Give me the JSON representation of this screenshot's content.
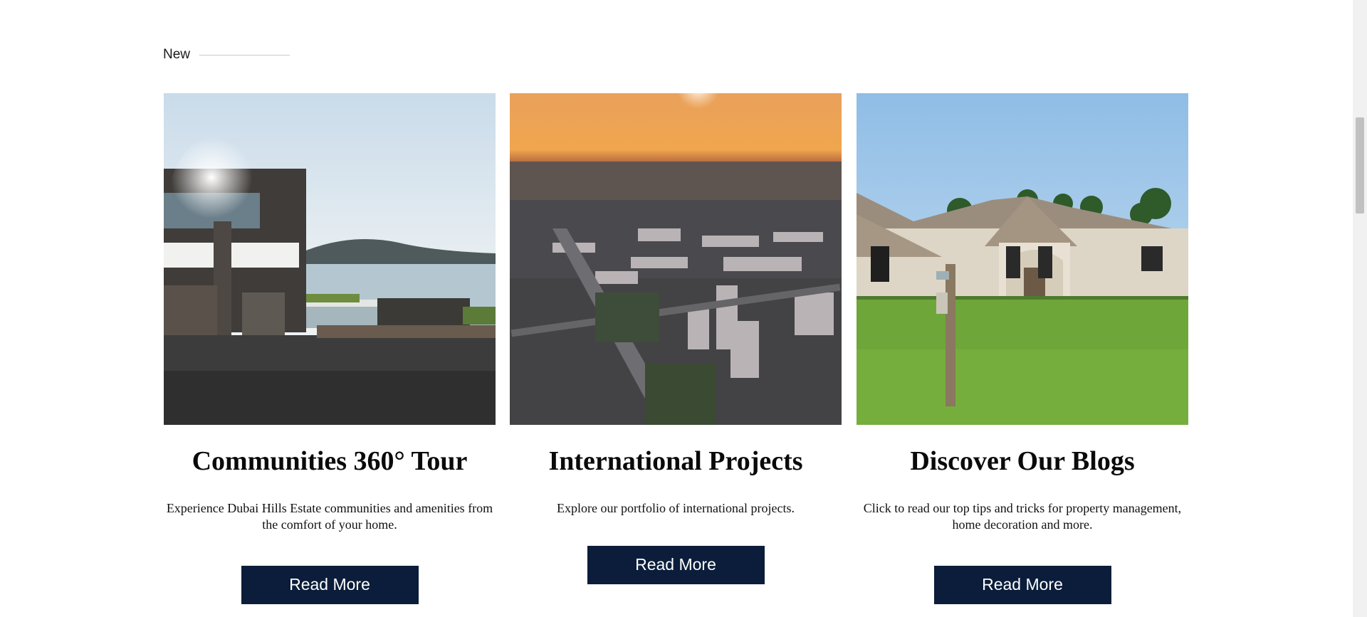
{
  "section": {
    "label": "New"
  },
  "cards": [
    {
      "title": "Communities 360° Tour",
      "description": "Experience Dubai Hills Estate communities and amenities from the comfort of your home.",
      "button_label": "Read More"
    },
    {
      "title": "International Projects",
      "description": "Explore our portfolio of international projects.",
      "button_label": "Read More"
    },
    {
      "title": "Discover Our Blogs",
      "description": "Click to read our top tips and tricks for property management, home decoration and more.",
      "button_label": "Read More"
    }
  ],
  "colors": {
    "button_bg": "#0b1d3a",
    "button_text": "#ffffff",
    "heading": "#0a0a0a"
  },
  "icons": [
    "scrollbar-thumb"
  ]
}
